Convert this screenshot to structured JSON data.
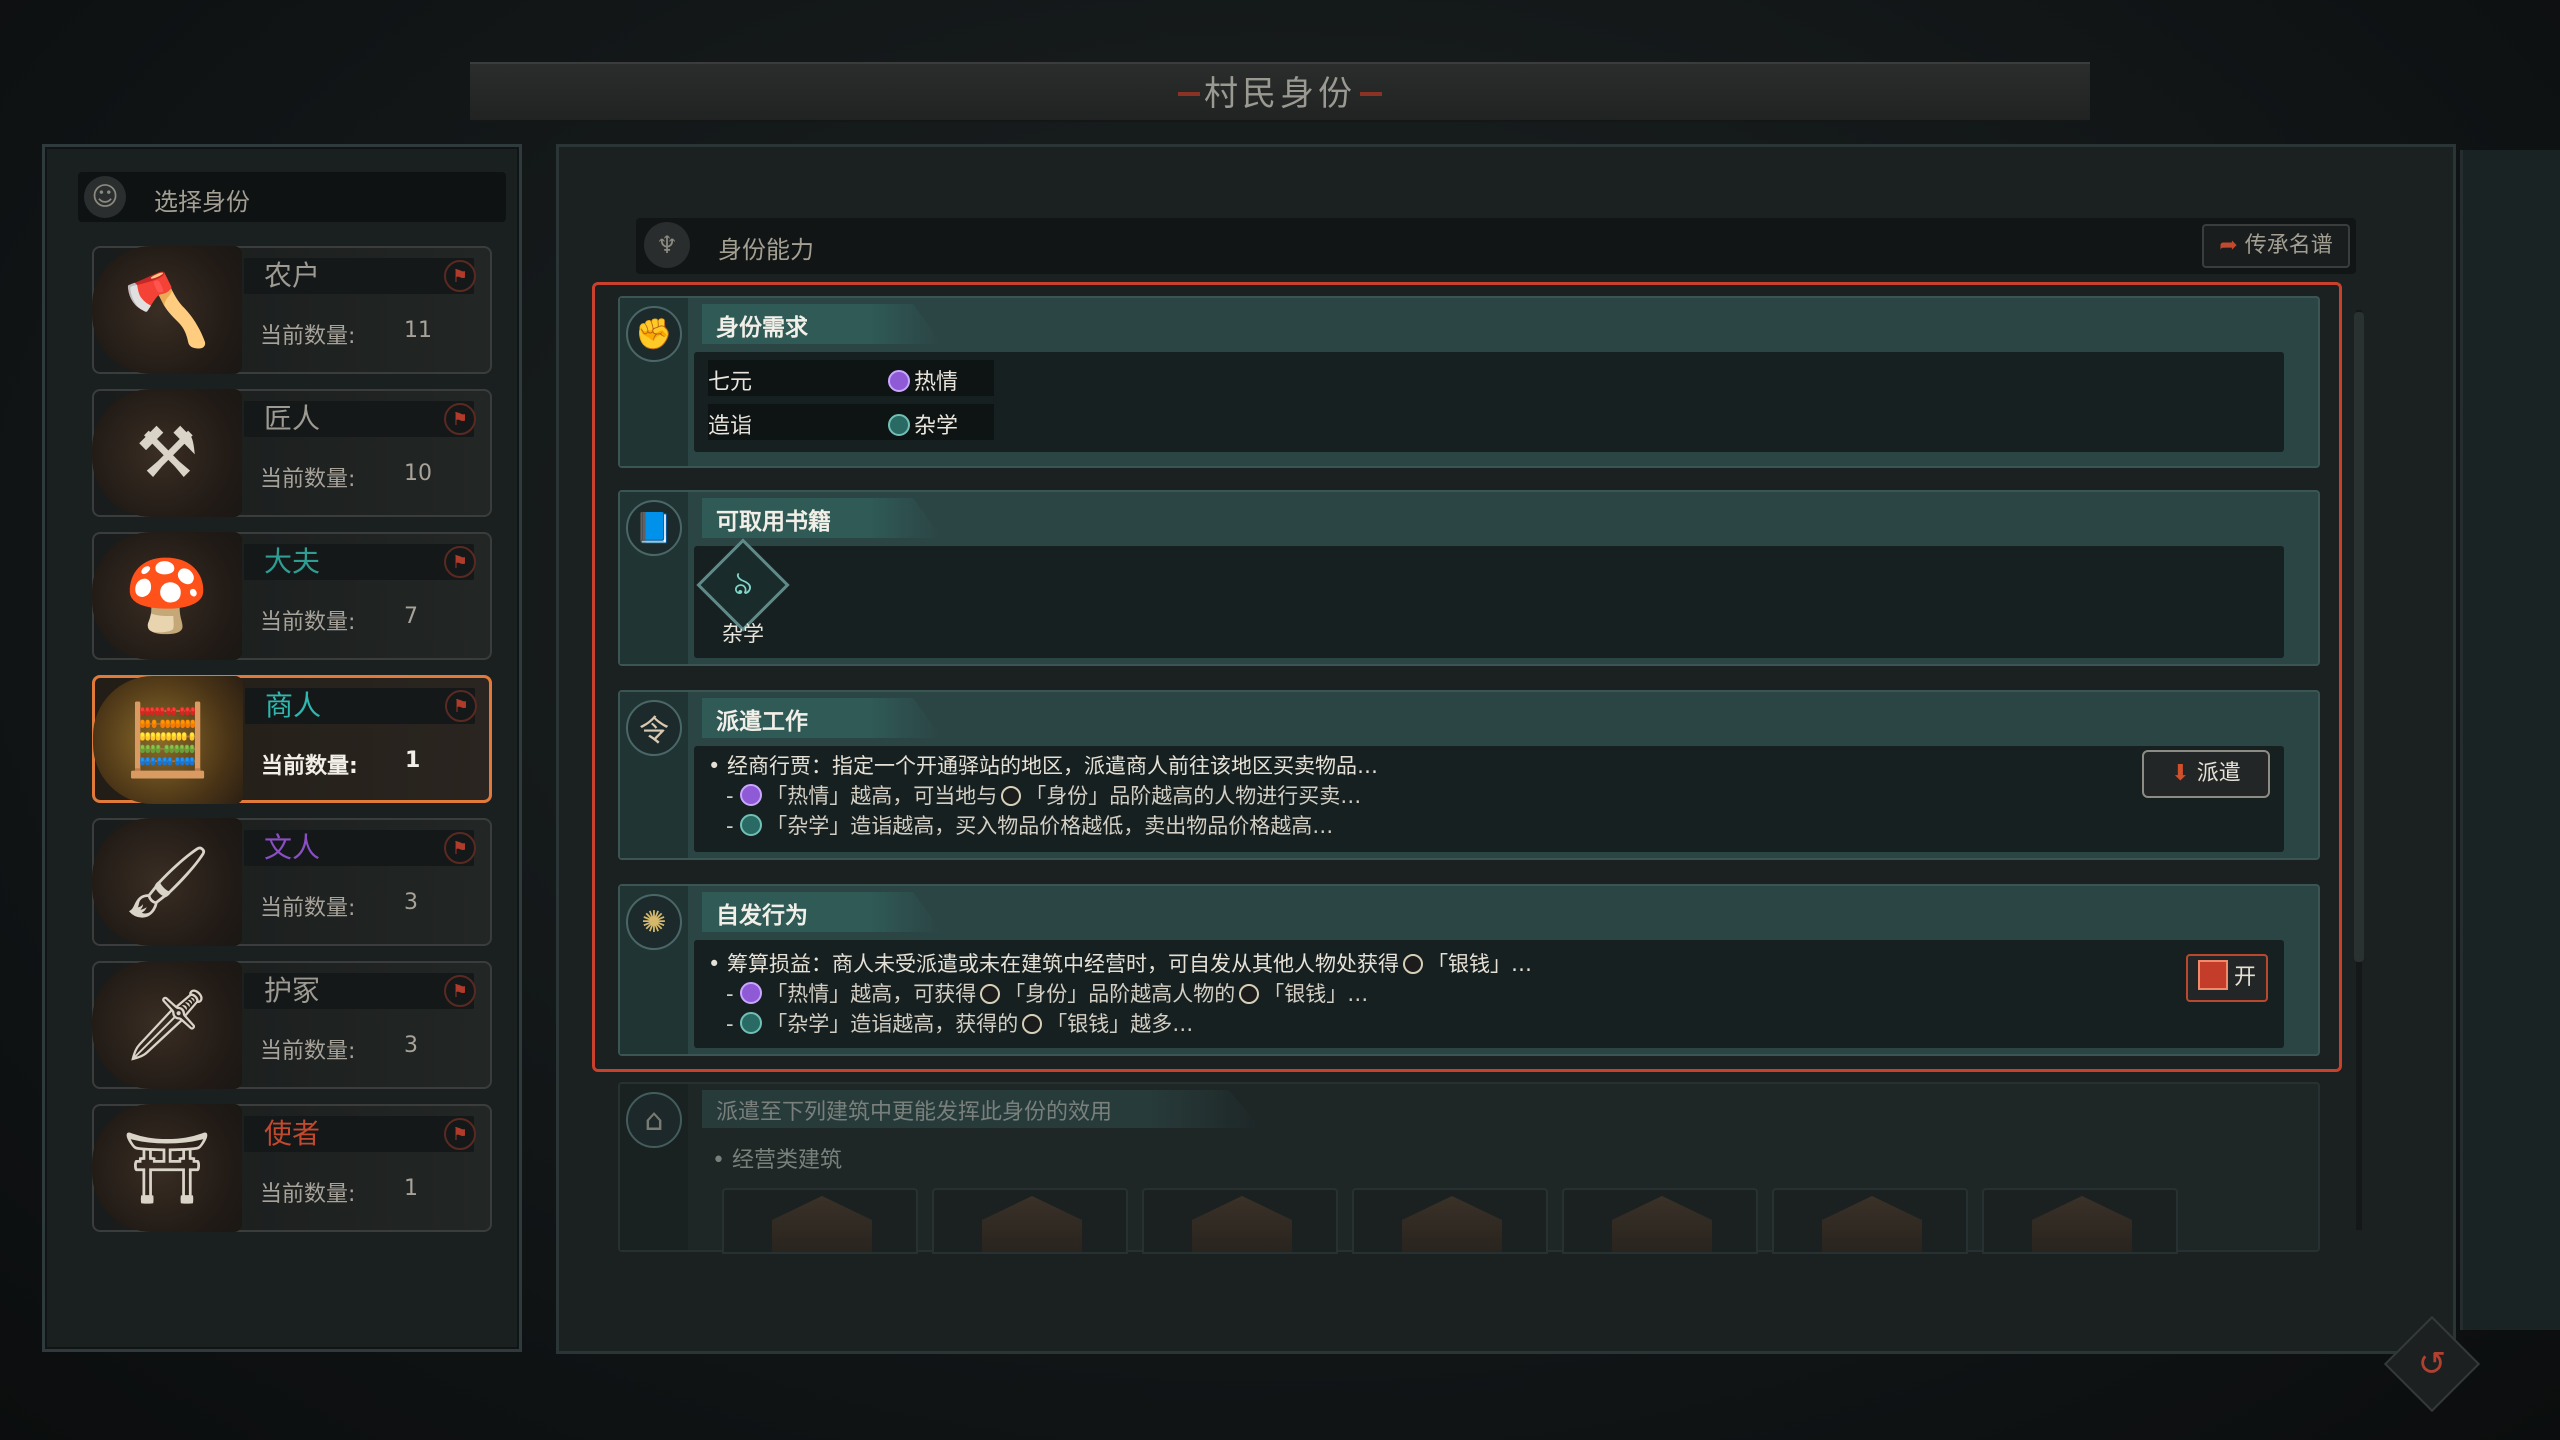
{
  "window": {
    "title": "村民身份"
  },
  "left_panel": {
    "header": "选择身份",
    "count_label": "当前数量:",
    "roles": [
      {
        "name": "农户",
        "count": "11",
        "name_color": "#9c9a92",
        "icon": "farmer-portrait",
        "selected": false
      },
      {
        "name": "匠人",
        "count": "10",
        "name_color": "#9c9a92",
        "icon": "craftsman-portrait",
        "selected": false
      },
      {
        "name": "大夫",
        "count": "7",
        "name_color": "#2e9e93",
        "icon": "doctor-portrait",
        "selected": false
      },
      {
        "name": "商人",
        "count": "1",
        "name_color": "#2fb8b0",
        "icon": "merchant-portrait",
        "selected": true
      },
      {
        "name": "文人",
        "count": "3",
        "name_color": "#8a4fc4",
        "icon": "scholar-portrait",
        "selected": false
      },
      {
        "name": "护冢",
        "count": "3",
        "name_color": "#9c9a92",
        "icon": "guardian-portrait",
        "selected": false
      },
      {
        "name": "使者",
        "count": "1",
        "name_color": "#c0492e",
        "icon": "envoy-portrait",
        "selected": false
      }
    ]
  },
  "main": {
    "header": "身份能力",
    "lineage_button": "传承名谱",
    "requirements": {
      "title": "身份需求",
      "rows": [
        {
          "name": "七元",
          "value": "热情",
          "icon": "passion-icon"
        },
        {
          "name": "造诣",
          "value": "杂学",
          "icon": "miscellany-icon"
        }
      ]
    },
    "books": {
      "title": "可取用书籍",
      "items": [
        {
          "label": "杂学",
          "glyph": "ঌ"
        }
      ]
    },
    "dispatch_work": {
      "title": "派遣工作",
      "main_line": "• 经商行贾：指定一个开通驿站的地区，派遣商人前往该地区买卖物品…",
      "sub1_pre": "- ",
      "sub1_a": "「热情」越高，可当地与",
      "sub1_b": "「身份」品阶越高的人物进行买卖…",
      "sub2_pre": "- ",
      "sub2_a": "「杂学」造诣越高，买入物品价格越低，卖出物品价格越高…",
      "button": "派遣"
    },
    "spontaneous": {
      "title": "自发行为",
      "main_a": "• 筹算损益：商人未受派遣或未在建筑中经营时，可自发从其他人物处获得",
      "main_b": "「银钱」…",
      "sub1_pre": "- ",
      "sub1_a": "「热情」越高，可获得",
      "sub1_b": "「身份」品阶越高人物的",
      "sub1_c": "「银钱」…",
      "sub2_pre": "- ",
      "sub2_a": "「杂学」造诣越高，获得的",
      "sub2_b": "「银钱」越多…",
      "toggle": "开"
    },
    "buildings": {
      "title": "派遣至下列建筑中更能发挥此身份的效用",
      "category": "• 经营类建筑"
    }
  },
  "colors": {
    "accent_red": "#c8412c",
    "selected_border": "#e07a3a",
    "section_teal": "#2b4444"
  }
}
